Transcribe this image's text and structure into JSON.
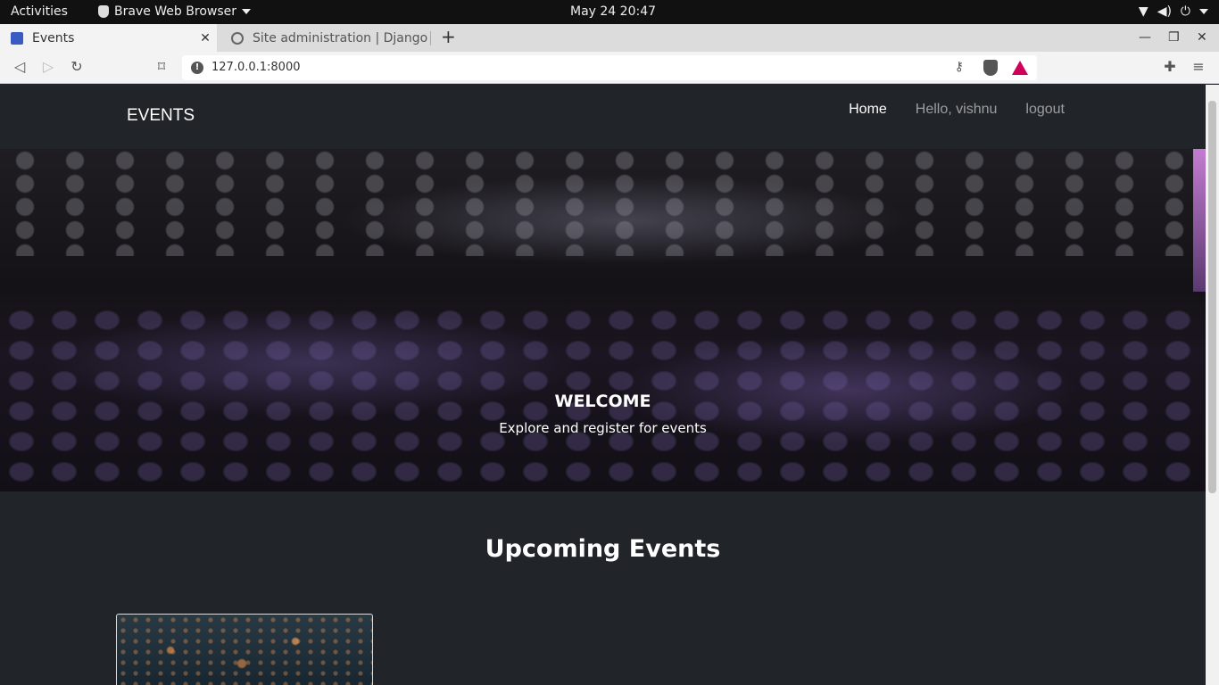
{
  "system_bar": {
    "activities": "Activities",
    "app_name": "Brave Web Browser",
    "clock": "May 24  20:47"
  },
  "tabs": [
    {
      "title": "Events",
      "active": true
    },
    {
      "title": "Site administration | Django s",
      "active": false
    }
  ],
  "toolbar": {
    "url": "127.0.0.1:8000"
  },
  "site": {
    "brand": "EVENTS",
    "nav": {
      "home": "Home",
      "greeting": "Hello, vishnu",
      "logout": "logout"
    },
    "hero": {
      "title": "WELCOME",
      "subtitle": "Explore and register for events"
    },
    "section_title": "Upcoming Events"
  },
  "colors": {
    "page_bg": "#212529",
    "accent_rewards": "#d1005a"
  }
}
